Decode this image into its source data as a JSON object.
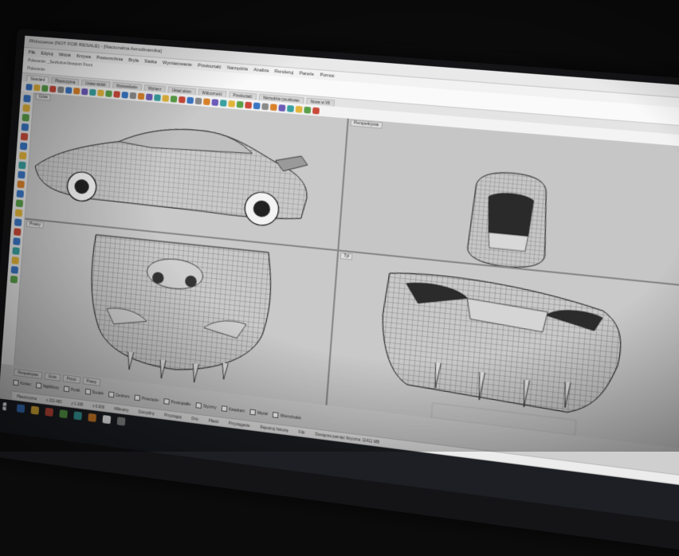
{
  "window": {
    "title": "Rhinoceros (NOT FOR RESALE) - [Nacionalna Aerodinamika]"
  },
  "menu": {
    "items": [
      "Plik",
      "Edytuj",
      "Widok",
      "Krzywa",
      "Powierzchnia",
      "Bryła",
      "Siatka",
      "Wymiarowanie",
      "Przekształć",
      "Narzędzia",
      "Analiza",
      "Renderuj",
      "Panele",
      "Pomoc"
    ]
  },
  "command": {
    "line1": "Polecenie: _SetActiveViewport Front",
    "line2": "Polecenie: _Zoom _Extents",
    "prompt": "Polecenie:"
  },
  "toolbar_tabs": [
    "Standard",
    "Płaszczyzna",
    "Ustaw widok",
    "Wyświetlanie",
    "Wybierz",
    "Układ okien",
    "Widoczność",
    "Przekształć",
    "Narzędzia rysunkowe",
    "Nowe w V6"
  ],
  "toolbar_icon_colors": [
    "#3a76c4",
    "#e3b43b",
    "#5aa04a",
    "#c94a3a",
    "#8a8a8a",
    "#3a76c4",
    "#d9822b",
    "#6c5bb7",
    "#3aa0a0",
    "#e3b43b",
    "#5aa04a",
    "#c94a3a",
    "#3a76c4",
    "#8a8a8a",
    "#d9822b",
    "#6c5bb7",
    "#3aa0a0",
    "#e3b43b",
    "#5aa04a",
    "#c94a3a",
    "#3a76c4",
    "#8a8a8a",
    "#d9822b",
    "#6c5bb7",
    "#3aa0a0",
    "#e3b43b",
    "#5aa04a",
    "#c94a3a",
    "#3a76c4",
    "#8a8a8a",
    "#d9822b",
    "#6c5bb7",
    "#3aa0a0",
    "#e3b43b",
    "#5aa04a",
    "#c94a3a"
  ],
  "view_tabs": [
    "Powierzchnia",
    "Bryła",
    "Siatka",
    "Renderuj",
    "Kreślenie",
    "Nowe w V6"
  ],
  "viewports": {
    "top_left": {
      "label": "Góra"
    },
    "top_right": {
      "label": "Perspektywa"
    },
    "bottom_left": {
      "label": "Prawy"
    },
    "bottom_right": {
      "label": "Tył"
    }
  },
  "viewport_tabs": [
    "Perspektywa",
    "Góra",
    "Przód",
    "Prawy"
  ],
  "osnap": [
    "Koniec",
    "Najbliższy",
    "Punkt",
    "Środek",
    "Centrum",
    "Przecięcie",
    "Prostopadle",
    "Styczny",
    "Kwadrant",
    "Węzeł",
    "Wierzchołek"
  ],
  "status": {
    "plane": "Płaszczyzna",
    "x": "x 232.480",
    "y": "y 1.108",
    "z": "z 0.000",
    "units": "Milimetry",
    "layer": "Domyślny",
    "grid_snap": "Przyciągaj",
    "ortho": "Orto",
    "planar": "Płaski",
    "osnap_label": "Przyciąganie",
    "record": "Rejestruj historię",
    "filter": "Filtr",
    "memory": "Dostępna pamięć fizyczna: 11411 MB"
  },
  "taskbar_icon_colors": [
    "#ffffff",
    "#3a76c4",
    "#e3b43b",
    "#c94a3a",
    "#5aa04a",
    "#3aa0a0",
    "#d9822b",
    "#ffffff",
    "#8a8a8a"
  ]
}
